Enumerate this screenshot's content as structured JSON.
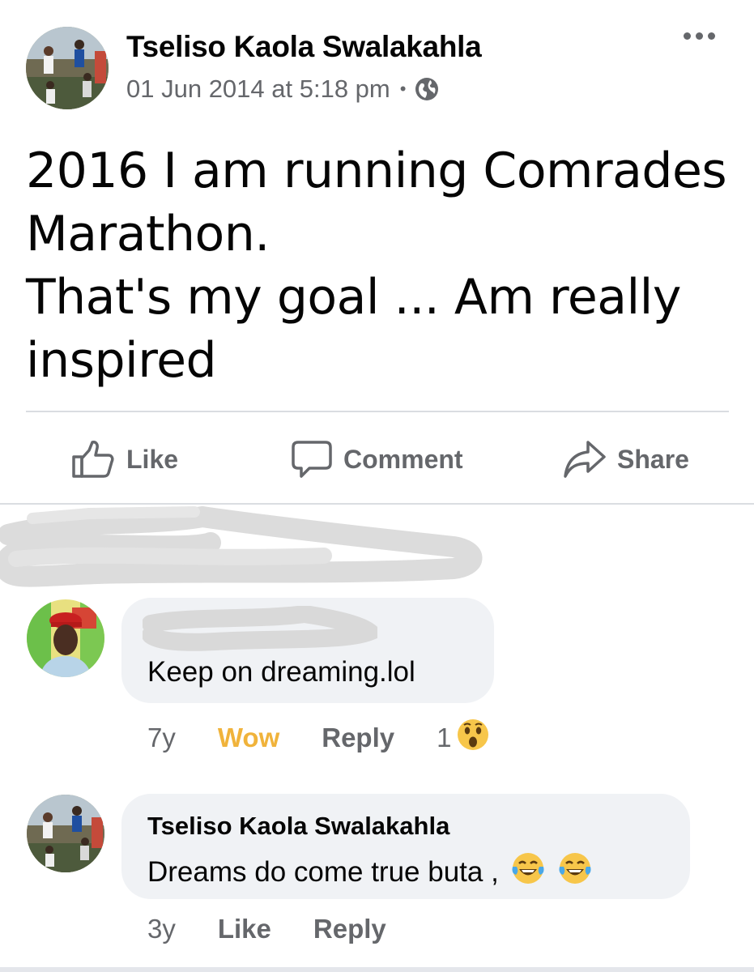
{
  "post": {
    "author_name": "Tseliso Kaola Swalakahla",
    "timestamp": "01 Jun 2014 at 5:18 pm",
    "meta_separator": "•",
    "privacy_icon": "globe-icon",
    "more_icon": "more-options-icon",
    "text_lines": [
      "2016 I am running Comrades",
      "Marathon.",
      "That's my goal ... Am really",
      "inspired"
    ]
  },
  "actions": {
    "like_label": "Like",
    "comment_label": "Comment",
    "share_label": "Share"
  },
  "comments": [
    {
      "author_name": "",
      "text": "Keep on dreaming.lol",
      "time": "7y",
      "reaction_label": "Wow",
      "reply_label": "Reply",
      "reaction_count": "1",
      "reaction_icon": "wow-emoji-icon"
    },
    {
      "author_name": "Tseliso Kaola Swalakahla",
      "text": "Dreams do come true buta ,",
      "emojis": [
        "laughing-tears-emoji-icon",
        "laughing-tears-emoji-icon"
      ],
      "time": "3y",
      "like_label": "Like",
      "reply_label": "Reply"
    }
  ],
  "colors": {
    "secondary_text": "#65676b",
    "bubble_bg": "#f0f2f5",
    "wow_active": "#f0b33b",
    "divider": "#dadde1"
  }
}
